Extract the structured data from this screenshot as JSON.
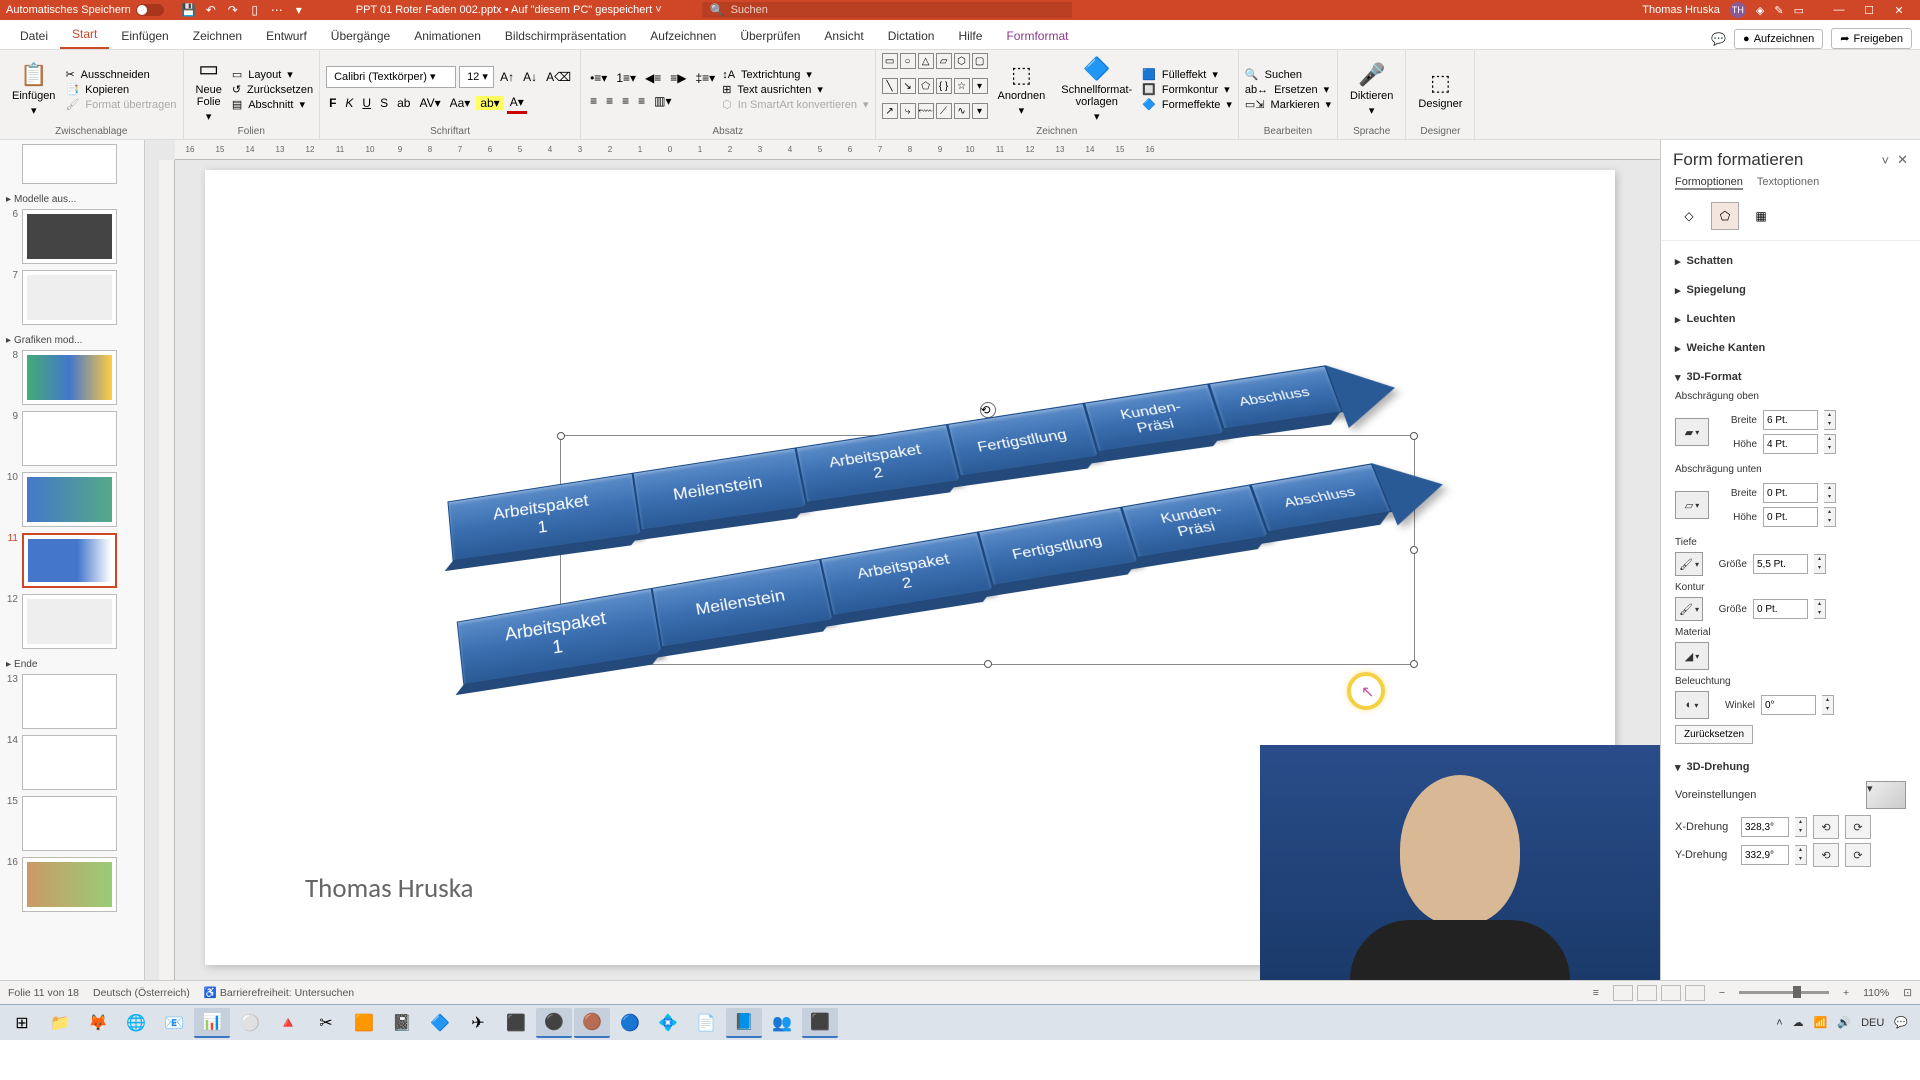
{
  "titlebar": {
    "autosave": "Automatisches Speichern",
    "doc": "PPT 01 Roter Faden 002.pptx • Auf \"diesem PC\" gespeichert",
    "search_ph": "Suchen",
    "user": "Thomas Hruska",
    "user_initials": "TH"
  },
  "tabs": {
    "datei": "Datei",
    "start": "Start",
    "einfuegen": "Einfügen",
    "zeichnen": "Zeichnen",
    "entwurf": "Entwurf",
    "uebergaenge": "Übergänge",
    "animationen": "Animationen",
    "bildschirm": "Bildschirmpräsentation",
    "aufzeichnen_tab": "Aufzeichnen",
    "ueberpruefen": "Überprüfen",
    "ansicht": "Ansicht",
    "dictation": "Dictation",
    "hilfe": "Hilfe",
    "formformat": "Formformat",
    "aufzeichnen_btn": "Aufzeichnen",
    "freigeben": "Freigeben"
  },
  "ribbon": {
    "zwischenablage": "Zwischenablage",
    "einfuegen": "Einfügen",
    "ausschneiden": "Ausschneiden",
    "kopieren": "Kopieren",
    "format_uebertragen": "Format übertragen",
    "folien": "Folien",
    "neue_folie": "Neue\nFolie",
    "layout": "Layout",
    "zuruecksetzen": "Zurücksetzen",
    "abschnitt": "Abschnitt",
    "schriftart": "Schriftart",
    "font": "Calibri (Textkörper)",
    "size": "12",
    "absatz": "Absatz",
    "textrichtung": "Textrichtung",
    "text_ausrichten": "Text ausrichten",
    "smartart": "In SmartArt konvertieren",
    "zeichnen": "Zeichnen",
    "anordnen": "Anordnen",
    "schnellformat": "Schnellformat-\nvorlagen",
    "fuelleffekt": "Fülleffekt",
    "formkontur": "Formkontur",
    "formeffekte": "Formeffekte",
    "bearbeiten": "Bearbeiten",
    "suchen": "Suchen",
    "ersetzen": "Ersetzen",
    "markieren": "Markieren",
    "sprache": "Sprache",
    "diktieren": "Diktieren",
    "designer_grp": "Designer",
    "designer": "Designer"
  },
  "thumbs": {
    "sec_modelle": "Modelle aus...",
    "sec_grafiken": "Grafiken mod...",
    "sec_ende": "Ende",
    "nums": [
      "6",
      "7",
      "8",
      "9",
      "10",
      "11",
      "12",
      "13",
      "14",
      "15",
      "16"
    ]
  },
  "slide": {
    "steps": [
      "Arbeitspaket\n1",
      "Meilenstein",
      "Arbeitspaket\n2",
      "Fertigstllung",
      "Kunden-\nPräsi",
      "Abschluss"
    ],
    "author": "Thomas Hruska"
  },
  "pane": {
    "title": "Form formatieren",
    "formoptionen": "Formoptionen",
    "textoptionen": "Textoptionen",
    "schatten": "Schatten",
    "spiegelung": "Spiegelung",
    "leuchten": "Leuchten",
    "weiche": "Weiche Kanten",
    "format3d": "3D-Format",
    "abschr_oben": "Abschrägung oben",
    "abschr_unten": "Abschrägung unten",
    "breite": "Breite",
    "hoehe": "Höhe",
    "b_oben": "6 Pt.",
    "h_oben": "4 Pt.",
    "b_unten": "0 Pt.",
    "h_unten": "0 Pt.",
    "tiefe": "Tiefe",
    "groesse": "Größe",
    "tiefe_val": "5,5 Pt.",
    "kontur": "Kontur",
    "kontur_val": "0 Pt.",
    "material": "Material",
    "beleuchtung": "Beleuchtung",
    "winkel": "Winkel",
    "winkel_val": "0°",
    "zurueck": "Zurücksetzen",
    "drehung3d": "3D-Drehung",
    "voreinst": "Voreinstellungen",
    "xdreh": "X-Drehung",
    "xdreh_val": "328,3°",
    "ydreh": "Y-Drehung",
    "ydreh_val": "332,9°"
  },
  "status": {
    "folie": "Folie 11 von 18",
    "lang": "Deutsch (Österreich)",
    "access": "Barrierefreiheit: Untersuchen",
    "zoom": "110%"
  },
  "tray": {
    "lang": "DEU"
  }
}
